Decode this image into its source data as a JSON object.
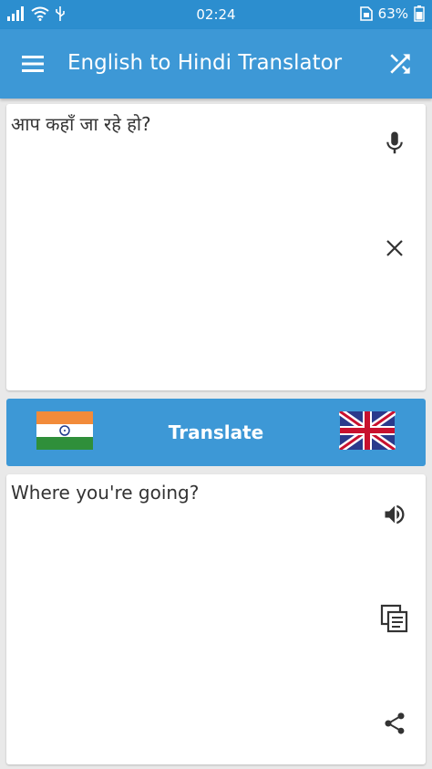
{
  "status": {
    "time": "02:24",
    "battery": "63%"
  },
  "appbar": {
    "title": "English to Hindi Translator"
  },
  "input": {
    "text": "आप कहाँ जा रहे हो?"
  },
  "translate": {
    "label": "Translate"
  },
  "output": {
    "text": "Where you're going?"
  },
  "colors": {
    "primary": "#3d98d6",
    "statusbar": "#2c8ecf",
    "background": "#e9e9e9"
  },
  "icons": [
    "menu-icon",
    "shuffle-icon",
    "microphone-icon",
    "close-icon",
    "india-flag-icon",
    "uk-flag-icon",
    "speaker-icon",
    "copy-icon",
    "share-icon"
  ]
}
